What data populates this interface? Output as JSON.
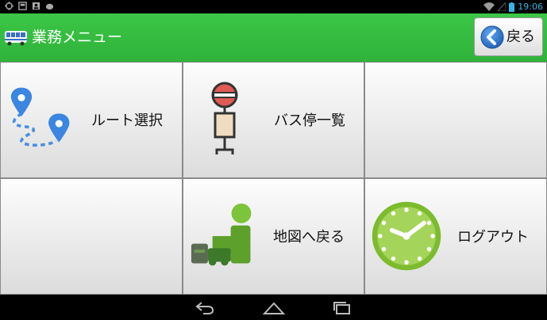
{
  "status_bar": {
    "time": "19:06",
    "icons": [
      "sync-icon",
      "storage-icon",
      "contact-icon",
      "android-icon",
      "wifi-icon",
      "signal-icon",
      "battery-icon"
    ]
  },
  "header": {
    "title": "業務メニュー",
    "icon": "bus-icon",
    "back_button_label": "戻る",
    "colors": {
      "bar": "#35bd40",
      "back_circle": "#2a73c8"
    }
  },
  "menu": {
    "tiles": [
      {
        "label": "ルート選択",
        "icon": "route-icon"
      },
      {
        "label": "バス停一覧",
        "icon": "bus-stop-icon"
      },
      {
        "label": "",
        "icon": ""
      },
      {
        "label": "",
        "icon": ""
      },
      {
        "label": "地図へ戻る",
        "icon": "map-icon"
      },
      {
        "label": "ログアウト",
        "icon": "clock-icon"
      }
    ]
  },
  "nav_bar": {
    "buttons": [
      "back-nav-icon",
      "home-nav-icon",
      "recents-nav-icon"
    ]
  }
}
